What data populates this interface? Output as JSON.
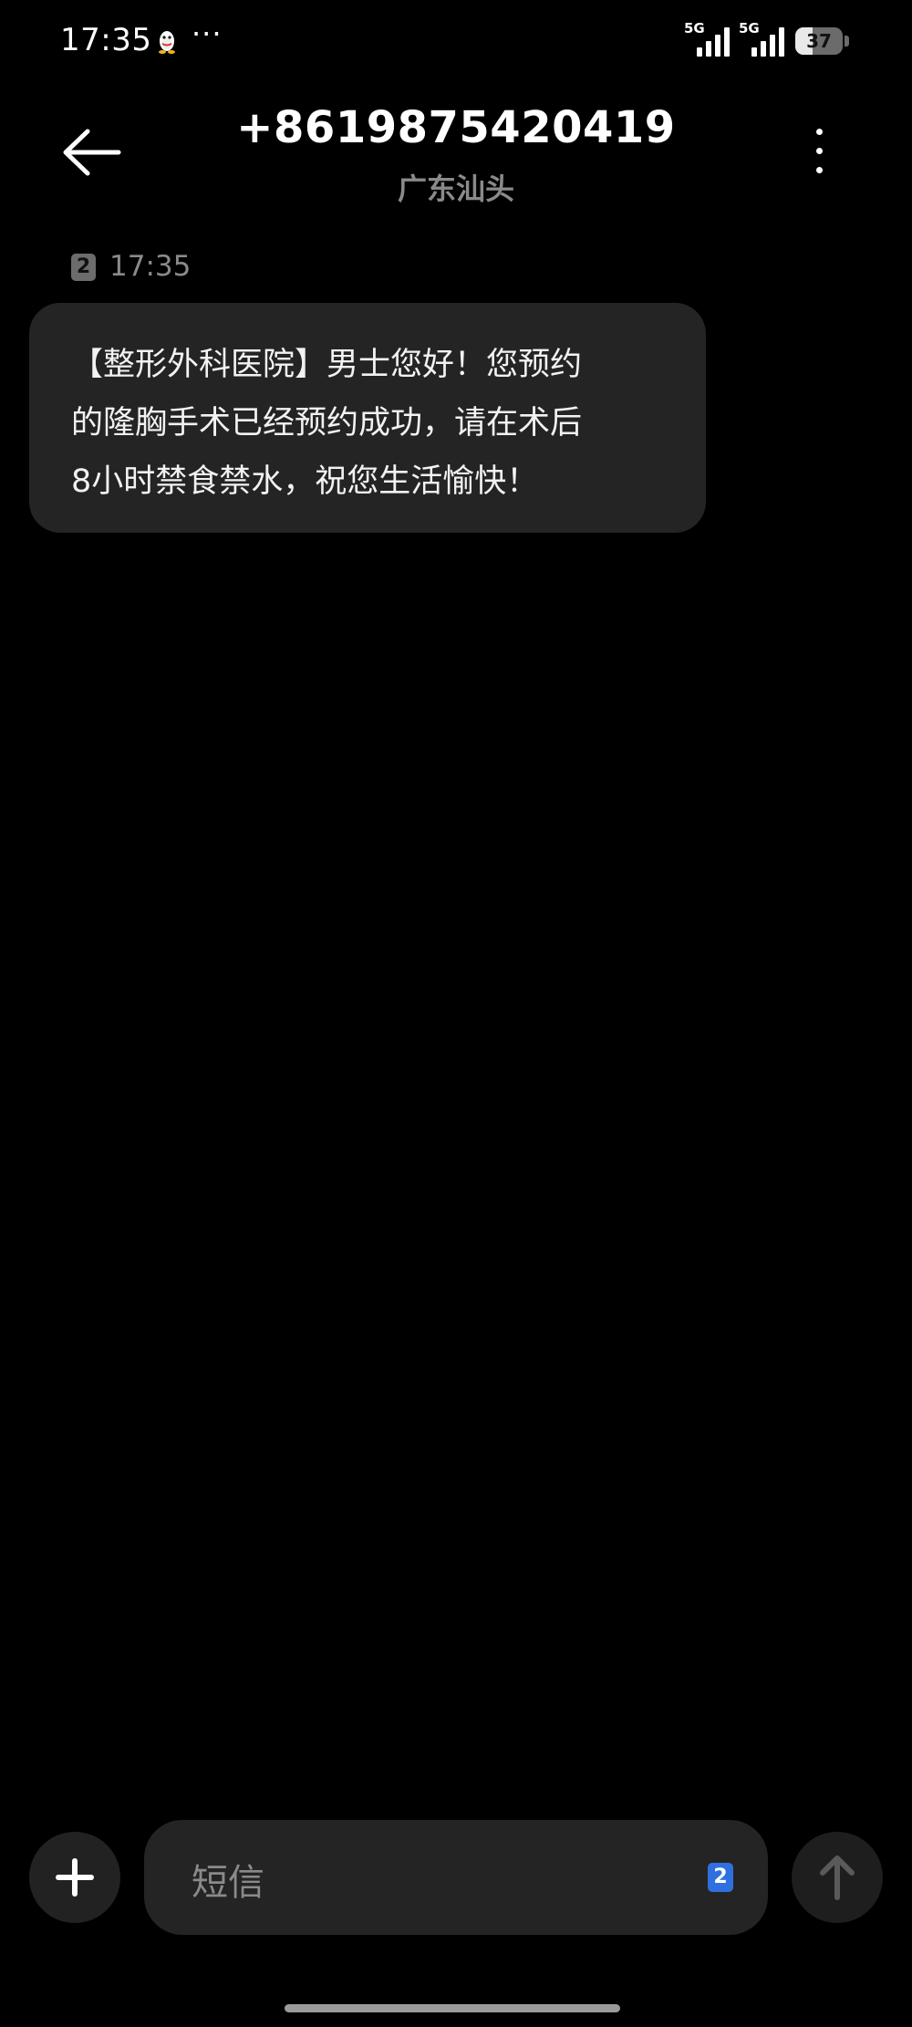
{
  "status_bar": {
    "time": "17:35",
    "more": "···",
    "network_1": "5G",
    "network_2": "5G",
    "battery_level": "37",
    "battery_fraction": 0.37
  },
  "header": {
    "contact_number": "+8619875420419",
    "location": "广东汕头"
  },
  "conversation": {
    "messages": [
      {
        "sim_slot": "2",
        "time": "17:35",
        "lines": [
          "【整形外科医院】男士您好！您预约",
          "的隆胸手术已经预约成功，请在术后",
          "8小时禁食禁水，祝您生活愉快！"
        ]
      }
    ]
  },
  "composer": {
    "placeholder": "短信",
    "sim_slot": "2"
  },
  "colors": {
    "background": "#000000",
    "bubble": "#242424",
    "secondary_text": "#8a8a8a",
    "sim_badge_active": "#2f6fe0"
  },
  "icons": {
    "back": "arrow-left-icon",
    "more": "vertical-dots-icon",
    "add": "plus-icon",
    "send": "arrow-up-icon",
    "notification": "qq-penguin-icon"
  }
}
